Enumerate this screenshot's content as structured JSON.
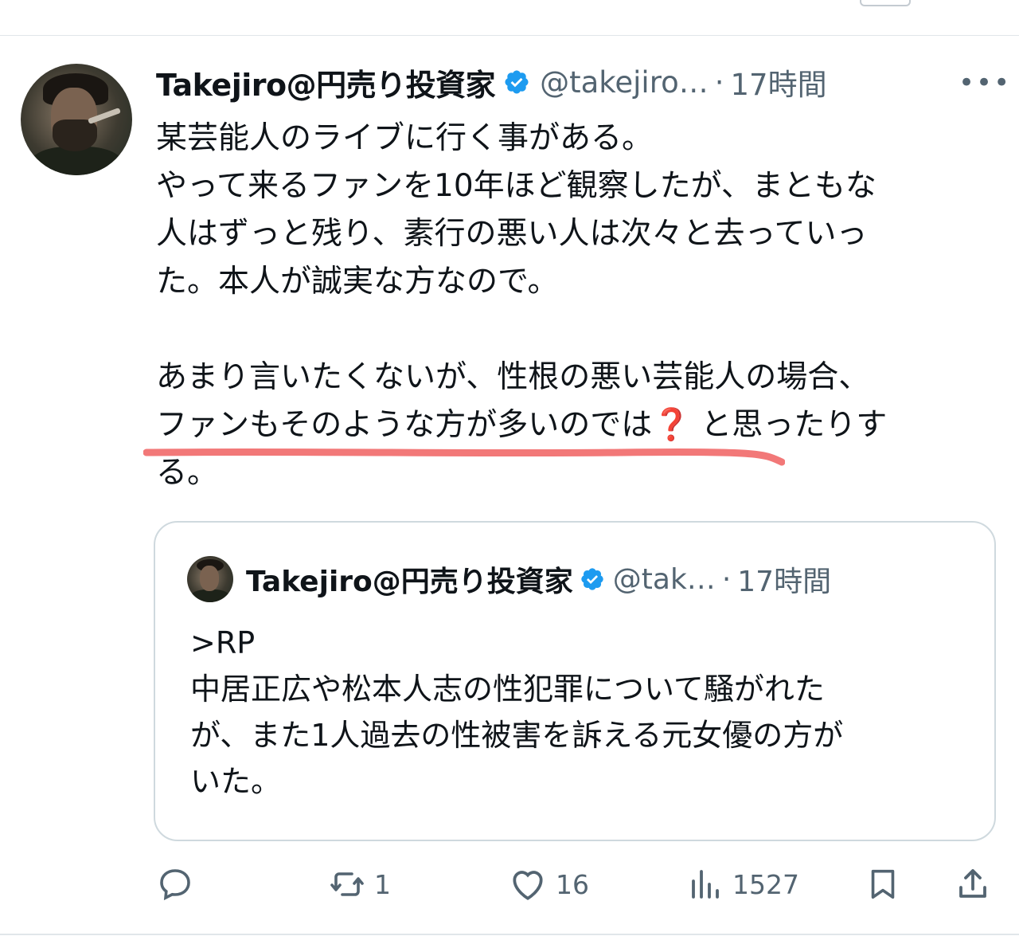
{
  "tweet": {
    "display_name": "Takejiro@円売り投資家",
    "handle": "@takejiro…",
    "separator": "·",
    "time": "17時間",
    "more": "•••",
    "lines": [
      "某芸能人のライブに行く事がある。",
      "やって来るファンを10年ほど観察したが、まともな",
      "人はずっと残り、素行の悪い人は次々と去っていっ",
      "た。本人が誠実な方なので。",
      "",
      "あまり言いたくないが、性根の悪い芸能人の場合、"
    ],
    "line7_before": "ファンもそのような方が多いのでは",
    "line7_emoji": "❓",
    "line7_after": " と思ったりす",
    "line8": "る。"
  },
  "quote": {
    "display_name": "Takejiro@円売り投資家",
    "handle": "@tak…",
    "separator": "·",
    "time": "17時間",
    "lines": [
      ">RP",
      "中居正広や松本人志の性犯罪について騒がれた",
      "が、また1人過去の性被害を訴える元女優の方が",
      "いた。"
    ]
  },
  "actions": {
    "reply_count": "",
    "retweet_count": "1",
    "like_count": "16",
    "views_count": "1527"
  },
  "colors": {
    "text": "#0f1419",
    "secondary": "#536471",
    "verified": "#1d9bf0",
    "underline": "#f27878",
    "border": "#cfd9de"
  }
}
